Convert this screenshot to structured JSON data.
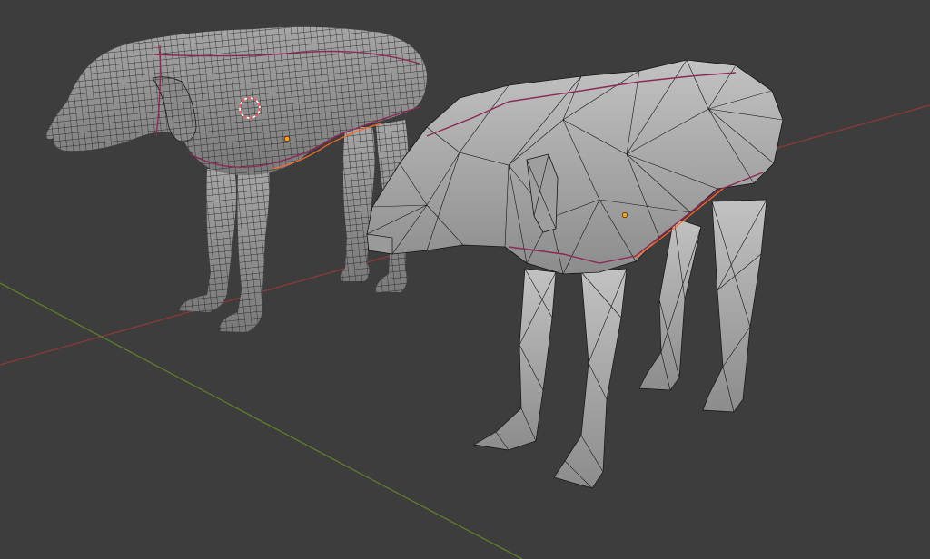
{
  "viewport": {
    "background": "#3d3d3d",
    "grid_floor_color": "#444444",
    "axes": {
      "x_axis_color": "#8a3a3a",
      "y_axis_color": "#5f7d2c"
    }
  },
  "objects": [
    {
      "name": "quad-mesh-dog",
      "topology": "quad",
      "selected": false
    },
    {
      "name": "low-poly-triangulated-dog",
      "topology": "triangulated",
      "selected": false
    }
  ],
  "icons": {
    "cursor": "3d-cursor-icon",
    "origin_1": "object-origin-icon",
    "origin_2": "object-origin-icon"
  },
  "colors": {
    "mesh_surface": "#8e8e8e",
    "mesh_surface_light": "#b4b4b4",
    "wireframe": "#141414",
    "seam": "#8a2a55",
    "origin": "#ff9d1e",
    "cursor_red": "#ff5050",
    "cursor_white": "#ffffff"
  }
}
